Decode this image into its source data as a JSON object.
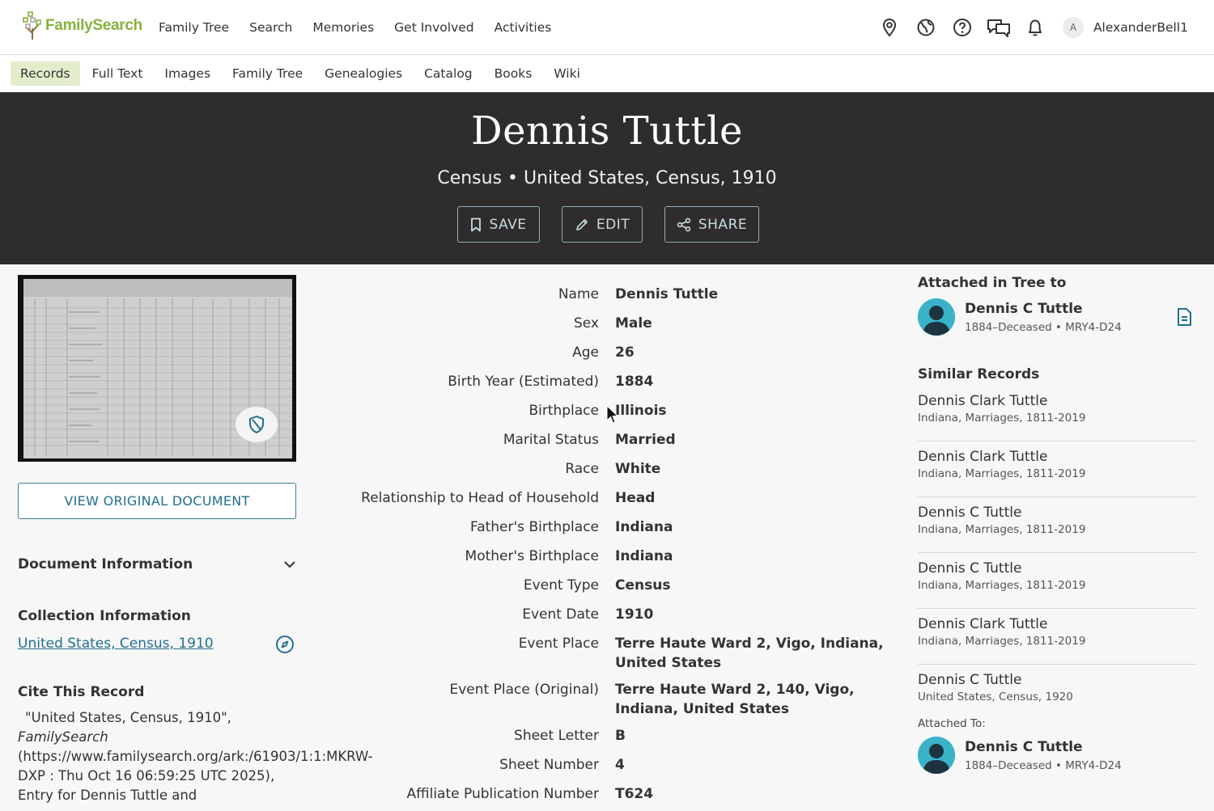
{
  "brand": {
    "name": "FamilySearch",
    "accent": "#87b240"
  },
  "main_nav": [
    "Family Tree",
    "Search",
    "Memories",
    "Get Involved",
    "Activities"
  ],
  "user": {
    "initial": "A",
    "username": "AlexanderBell1"
  },
  "utility_icons": [
    "location-pin-icon",
    "globe-icon",
    "help-icon",
    "chat-icon",
    "bell-icon"
  ],
  "sub_nav": [
    "Records",
    "Full Text",
    "Images",
    "Family Tree",
    "Genealogies",
    "Catalog",
    "Books",
    "Wiki"
  ],
  "sub_nav_active": "Records",
  "hero": {
    "title": "Dennis Tuttle",
    "subtitle": "Census • United States, Census, 1910",
    "buttons": {
      "save": "SAVE",
      "edit": "EDIT",
      "share": "SHARE"
    }
  },
  "left": {
    "view_button": "VIEW ORIGINAL DOCUMENT",
    "document_info_heading": "Document Information",
    "collection_heading": "Collection Information",
    "collection_link": "United States, Census, 1910",
    "cite_heading": "Cite This Record",
    "cite_line1": "\"United States, Census, 1910\",",
    "cite_source": "FamilySearch",
    "cite_rest": "(https://www.familysearch.org/ark:/61903/1:1:MKRW-DXP : Thu Oct 16 06:59:25 UTC 2025), Entry for Dennis Tuttle and"
  },
  "fields": [
    {
      "label": "Name",
      "value": "Dennis Tuttle"
    },
    {
      "label": "Sex",
      "value": "Male"
    },
    {
      "label": "Age",
      "value": "26"
    },
    {
      "label": "Birth Year (Estimated)",
      "value": "1884"
    },
    {
      "label": "Birthplace",
      "value": "Illinois"
    },
    {
      "label": "Marital Status",
      "value": "Married"
    },
    {
      "label": "Race",
      "value": "White"
    },
    {
      "label": "Relationship to Head of Household",
      "value": "Head"
    },
    {
      "label": "Father's Birthplace",
      "value": "Indiana"
    },
    {
      "label": "Mother's Birthplace",
      "value": "Indiana"
    },
    {
      "label": "Event Type",
      "value": "Census"
    },
    {
      "label": "Event Date",
      "value": "1910"
    },
    {
      "label": "Event Place",
      "value": "Terre Haute Ward 2, Vigo, Indiana, United States"
    },
    {
      "label": "Event Place (Original)",
      "value": "Terre Haute Ward 2, 140, Vigo, Indiana, United States"
    },
    {
      "label": "Sheet Letter",
      "value": "B"
    },
    {
      "label": "Sheet Number",
      "value": "4"
    },
    {
      "label": "Affiliate Publication Number",
      "value": "T624"
    }
  ],
  "right": {
    "attached_heading": "Attached in Tree to",
    "attached_person": {
      "name": "Dennis C Tuttle",
      "meta": "1884–Deceased • MRY4-D24"
    },
    "similar_heading": "Similar Records",
    "similar": [
      {
        "name": "Dennis Clark Tuttle",
        "meta": "Indiana, Marriages, 1811-2019"
      },
      {
        "name": "Dennis Clark Tuttle",
        "meta": "Indiana, Marriages, 1811-2019"
      },
      {
        "name": "Dennis C Tuttle",
        "meta": "Indiana, Marriages, 1811-2019"
      },
      {
        "name": "Dennis C Tuttle",
        "meta": "Indiana, Marriages, 1811-2019"
      },
      {
        "name": "Dennis Clark Tuttle",
        "meta": "Indiana, Marriages, 1811-2019"
      },
      {
        "name": "Dennis C Tuttle",
        "meta": "United States, Census, 1920"
      }
    ],
    "attached_to_label": "Attached To:",
    "attached_to_person": {
      "name": "Dennis C Tuttle",
      "meta": "1884–Deceased • MRY4-D24"
    }
  },
  "colors": {
    "link": "#216f8e",
    "hero_bg": "#2e2c2c",
    "subnav_active_bg": "#e3edcc"
  }
}
